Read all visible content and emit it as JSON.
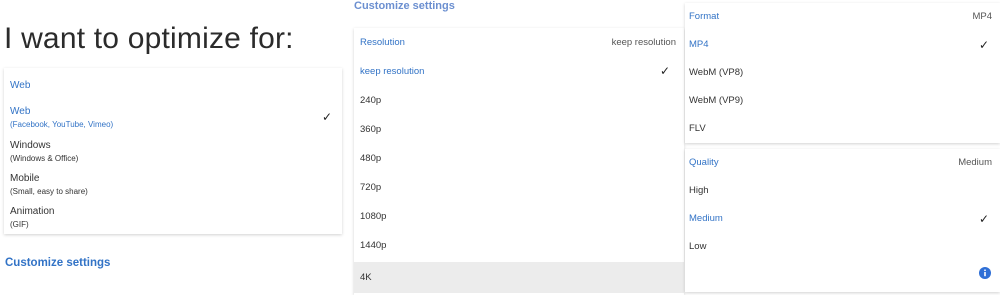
{
  "optimize": {
    "title": "I want to optimize for:",
    "header": "Web",
    "options": [
      {
        "label": "Web",
        "sub": "(Facebook, YouTube, Vimeo)",
        "selected": true
      },
      {
        "label": "Windows",
        "sub": "(Windows & Office)",
        "selected": false
      },
      {
        "label": "Mobile",
        "sub": "(Small, easy to share)",
        "selected": false
      },
      {
        "label": "Animation",
        "sub": "(GIF)",
        "selected": false
      }
    ],
    "customize_link": "Customize settings"
  },
  "customize": {
    "title": "Customize settings",
    "resolution": {
      "label": "Resolution",
      "value": "keep resolution",
      "options": [
        "keep resolution",
        "240p",
        "360p",
        "480p",
        "720p",
        "1080p",
        "1440p",
        "4K"
      ],
      "selected_index": 0,
      "hovered_index": 7
    },
    "format": {
      "label": "Format",
      "value": "MP4",
      "options": [
        "MP4",
        "WebM (VP8)",
        "WebM (VP9)",
        "FLV"
      ],
      "selected_index": 0
    },
    "quality": {
      "label": "Quality",
      "value": "Medium",
      "options": [
        "High",
        "Medium",
        "Low"
      ],
      "selected_index": 1
    }
  },
  "icons": {
    "check": "check-icon",
    "info": "info-icon"
  },
  "colors": {
    "accent": "#3273c6",
    "title_muted": "#6b8fd0",
    "hover_row": "#ececec"
  }
}
